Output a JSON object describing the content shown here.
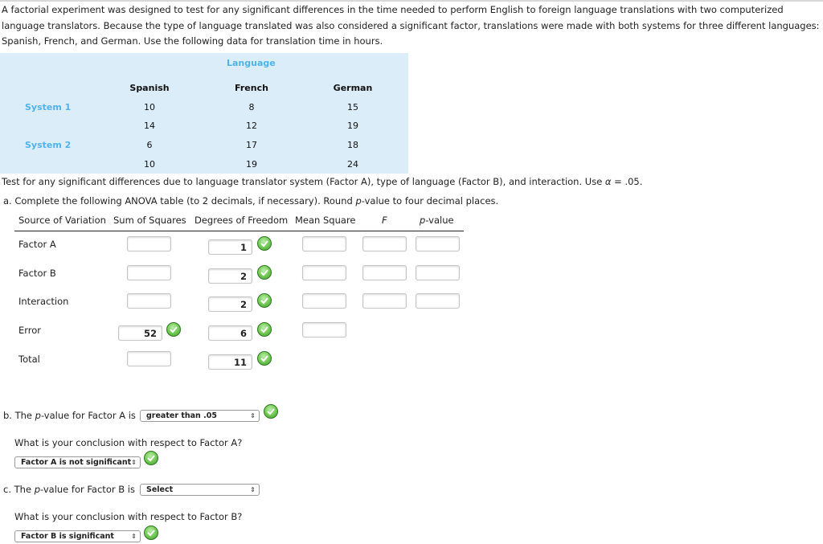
{
  "intro": "A factorial experiment was designed to test for any significant differences in the time needed to perform English to foreign language translations with two computerized language translators. Because the type of language translated was also considered a significant factor, translations were made with both systems for three different languages: Spanish, French, and German. Use the following data for translation time in hours.",
  "data_table": {
    "group_header": "Language",
    "columns": [
      "Spanish",
      "French",
      "German"
    ],
    "rows": [
      {
        "label": "System 1",
        "values": [
          "10",
          "8",
          "15"
        ]
      },
      {
        "label": "",
        "values": [
          "14",
          "12",
          "19"
        ]
      },
      {
        "label": "System 2",
        "values": [
          "6",
          "17",
          "18"
        ]
      },
      {
        "label": "",
        "values": [
          "10",
          "19",
          "24"
        ]
      }
    ]
  },
  "question_test": {
    "text": "Test for any significant differences due to language translator system (Factor A), type of language (Factor B), and interaction. Use ",
    "alpha_symbol": "α",
    "alpha_rest": " = .05."
  },
  "part_a": {
    "prefix": "a. Complete the following ANOVA table (to 2 decimals, if necessary). Round ",
    "p": "p",
    "suffix": "-value to four decimal places."
  },
  "anova": {
    "headers": {
      "source": "Source of Variation",
      "ss": "Sum of Squares",
      "df": "Degrees of Freedom",
      "ms": "Mean Square",
      "f": "F",
      "p_prefix": "p",
      "p_suffix": "-value"
    },
    "rows": [
      {
        "label": "Factor A",
        "ss": "",
        "df": "1",
        "ms": "",
        "f": "",
        "p": ""
      },
      {
        "label": "Factor B",
        "ss": "",
        "df": "2",
        "ms": "",
        "f": "",
        "p": ""
      },
      {
        "label": "Interaction",
        "ss": "",
        "df": "2",
        "ms": "",
        "f": "",
        "p": ""
      },
      {
        "label": "Error",
        "ss": "52",
        "df": "6",
        "ms": ""
      },
      {
        "label": "Total",
        "ss": "",
        "df": "11"
      }
    ]
  },
  "part_b": {
    "prefix": "b. The ",
    "p": "p",
    "suffix": "-value for Factor A is",
    "select_value": "greater than .05",
    "conclusion_question": "What is your conclusion with respect to Factor A?",
    "conclusion_value": "Factor A is not significant"
  },
  "part_c": {
    "prefix": "c. The ",
    "p": "p",
    "suffix": "-value for Factor B is",
    "select_value": "Select",
    "conclusion_question": "What is your conclusion with respect to Factor B?",
    "conclusion_value": "Factor B is significant"
  },
  "colors": {
    "table_bg": "#dcedfa",
    "accent_blue": "#4fb3e8",
    "check_green": "#5cb84a"
  }
}
